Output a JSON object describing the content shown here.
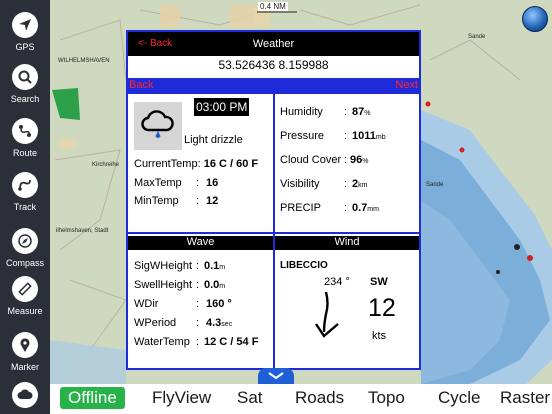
{
  "sidebar": {
    "items": [
      {
        "label": "GPS",
        "icon": "gps-arrow-icon"
      },
      {
        "label": "Search",
        "icon": "search-icon"
      },
      {
        "label": "Route",
        "icon": "route-icon"
      },
      {
        "label": "Track",
        "icon": "track-icon"
      },
      {
        "label": "Compass",
        "icon": "compass-icon"
      },
      {
        "label": "Measure",
        "icon": "ruler-icon"
      },
      {
        "label": "Marker",
        "icon": "map-pin-icon"
      },
      {
        "label": "",
        "icon": "weather-cloud-icon"
      }
    ]
  },
  "map_labels": {
    "scale": "0.4 NM",
    "town1": "WILHELMSHAVEN",
    "town2": "Kirchreihe",
    "town3": "ilhelmshaven, Stadt",
    "town4": "Sande",
    "town5": "Sande"
  },
  "weather": {
    "back_top": "<- Back",
    "title": "Weather",
    "coordinates": "53.526436 8.159988",
    "back": "Back",
    "next": "Next",
    "time": "03:00 PM",
    "condition": "Light drizzle",
    "current_temp_label": "CurrentTemp:",
    "current_temp_value": "16 C  / 60 F",
    "max_temp_label": "MaxTemp",
    "max_temp_value": "16",
    "min_temp_label": "MinTemp",
    "min_temp_value": "12",
    "humidity_label": "Humidity",
    "humidity_value": "87",
    "humidity_unit": "%",
    "pressure_label": "Pressure",
    "pressure_value": "1011",
    "pressure_unit": "mb",
    "cloud_label": "Cloud Cover",
    "cloud_value": "96",
    "cloud_unit": "%",
    "visibility_label": "Visibility",
    "visibility_value": "2",
    "visibility_unit": "km",
    "precip_label": "PRECIP",
    "precip_value": "0.7",
    "precip_unit": "mm"
  },
  "wave": {
    "title": "Wave",
    "sig_label": "SigWHeight",
    "sig_value": "0.1",
    "sig_unit": "m",
    "swell_label": "SwellHeight",
    "swell_value": "0.0",
    "swell_unit": "m",
    "wdir_label": "WDir",
    "wdir_value": "160 °",
    "wperiod_label": "WPeriod",
    "wperiod_value": "4.3",
    "wperiod_unit": "sec",
    "watertemp_label": "WaterTemp",
    "watertemp_value": "12 C / 54 F"
  },
  "wind": {
    "title": "Wind",
    "name": "LIBECCIO",
    "degrees": "234 °",
    "cardinal": "SW",
    "speed": "12",
    "unit": "kts"
  },
  "bottom_tabs": [
    "Offline",
    "FlyView",
    "Sat",
    "Roads",
    "Topo",
    "Cycle",
    "Raster"
  ],
  "active_tab": "Offline",
  "colors": {
    "accent_blue": "#1f2bd9",
    "active_tab_green": "#28b34a",
    "back_red": "#ff2a2a",
    "sidebar": "#2b2f38"
  }
}
